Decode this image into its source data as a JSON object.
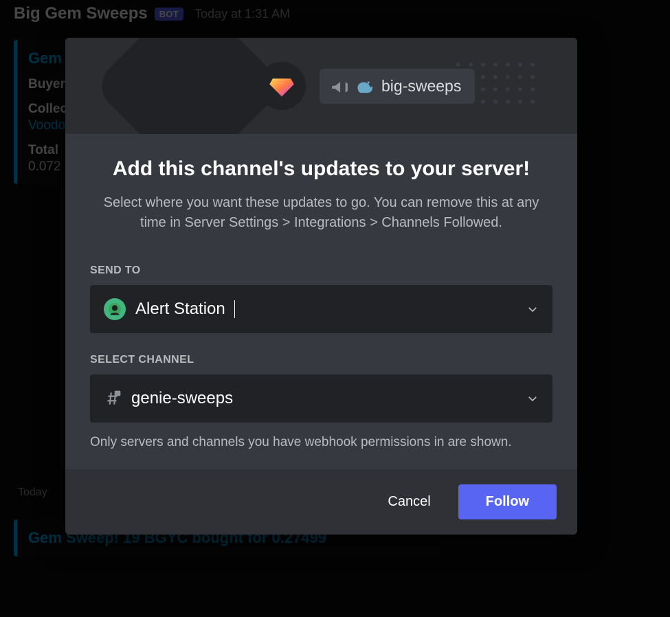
{
  "background": {
    "author": "Big Gem Sweeps",
    "bot_tag": "BOT",
    "timestamp": "Today at 1:31 AM",
    "embed1": {
      "title_prefix": "Gem",
      "buyer_label": "Buyer",
      "collection_label": "Collec",
      "collection_value": "Voodo",
      "total_label": "Total ",
      "total_value": "0.072"
    },
    "separator": "Today ",
    "embed2_title": "Gem Sweep! 19 BGYC bought for 0.27499"
  },
  "modal": {
    "channel_chip": "big-sweeps",
    "title": "Add this channel's updates to your server!",
    "description": "Select where you want these updates to go. You can remove this at any time in Server Settings > Integrations > Channels Followed.",
    "send_to_label": "SEND TO",
    "server_value": "Alert Station",
    "select_channel_label": "SELECT CHANNEL",
    "channel_value": "genie-sweeps",
    "hint": "Only servers and channels you have webhook permissions in are shown.",
    "cancel": "Cancel",
    "follow": "Follow"
  }
}
